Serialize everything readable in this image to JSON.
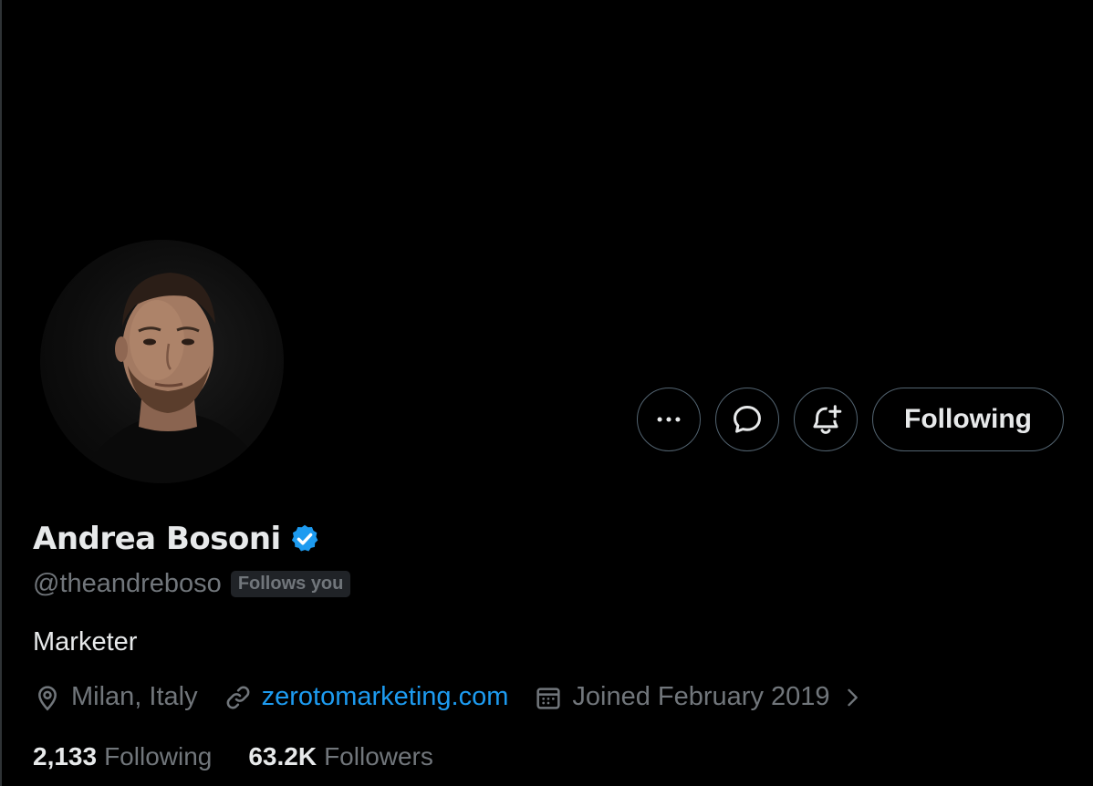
{
  "profile": {
    "display_name": "Andrea Bosoni",
    "handle": "@theandreboso",
    "follows_you_label": "Follows you",
    "bio": "Marketer",
    "location": "Milan, Italy",
    "website": "zerotomarketing.com",
    "joined": "Joined February 2019",
    "verified_color": "#1d9bf0"
  },
  "actions": {
    "more_icon": "more-horizontal-icon",
    "message_icon": "message-bubble-icon",
    "notify_icon": "bell-plus-icon",
    "follow_label": "Following"
  },
  "stats": {
    "following_count": "2,133",
    "following_label": "Following",
    "followers_count": "63.2K",
    "followers_label": "Followers"
  },
  "colors": {
    "background": "#000000",
    "text_primary": "#e7e9ea",
    "text_secondary": "#71767b",
    "link": "#1d9bf0",
    "border": "#536471"
  }
}
